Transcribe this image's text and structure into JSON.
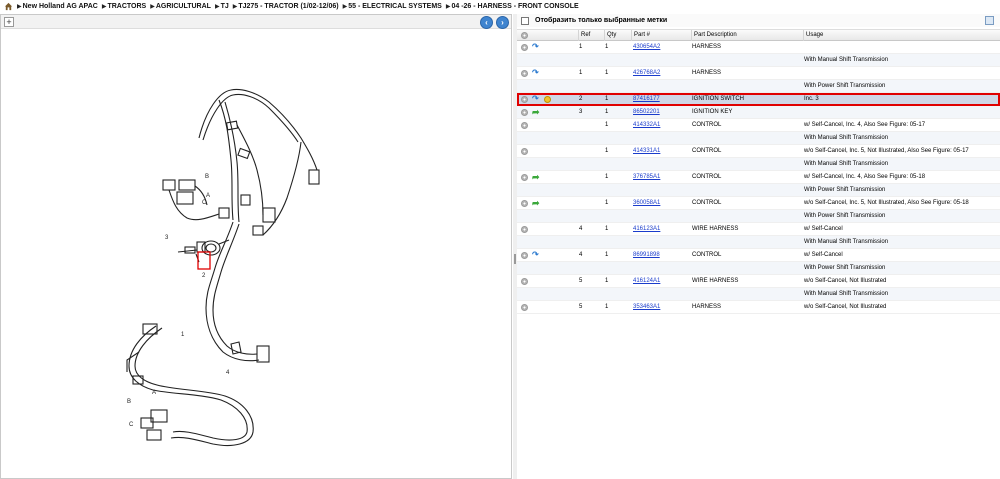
{
  "breadcrumb": {
    "items": [
      "New Holland AG APAC",
      "TRACTORS",
      "AGRICULTURAL",
      "TJ",
      "TJ275 - TRACTOR (1/02-12/06)",
      "55 - ELECTRICAL SYSTEMS",
      "04 -26 - HARNESS - FRONT CONSOLE"
    ]
  },
  "diagram": {
    "callouts": [
      "1",
      "2",
      "3",
      "4",
      "A",
      "B",
      "C",
      "A",
      "B",
      "C"
    ]
  },
  "filter": {
    "label": "Отобразить только выбранные метки",
    "checked": false
  },
  "table": {
    "headers": [
      "Ref",
      "Qty",
      "Part #",
      "Part Description",
      "Usage"
    ],
    "rows": [
      {
        "icons": "blue",
        "ref": "1",
        "qty": "1",
        "part": "430654A2",
        "desc": "HARNESS",
        "usage": ""
      },
      {
        "icons": "",
        "ref": "",
        "qty": "",
        "part": "",
        "desc": "",
        "usage": "With Manual Shift Transmission"
      },
      {
        "icons": "blue",
        "ref": "1",
        "qty": "1",
        "part": "426768A2",
        "desc": "HARNESS",
        "usage": ""
      },
      {
        "icons": "",
        "ref": "",
        "qty": "",
        "part": "",
        "desc": "",
        "usage": "With Power Shift Transmission"
      },
      {
        "icons": "blue-yellow",
        "ref": "2",
        "qty": "1",
        "part": "87416177",
        "desc": "IGNITION SWITCH",
        "usage": "Inc. 3",
        "selected": true
      },
      {
        "icons": "green",
        "ref": "3",
        "qty": "1",
        "part": "86502201",
        "desc": "IGNITION KEY",
        "usage": ""
      },
      {
        "icons": "",
        "ref": "",
        "qty": "1",
        "part": "414332A1",
        "desc": "CONTROL",
        "usage": "w/ Self-Cancel, Inc. 4, Also See Figure: 05-17"
      },
      {
        "icons": "",
        "ref": "",
        "qty": "",
        "part": "",
        "desc": "",
        "usage": "With Manual Shift Transmission"
      },
      {
        "icons": "",
        "ref": "",
        "qty": "1",
        "part": "414331A1",
        "desc": "CONTROL",
        "usage": "w/o Self-Cancel, Inc. 5, Not Illustrated, Also See Figure: 05-17"
      },
      {
        "icons": "",
        "ref": "",
        "qty": "",
        "part": "",
        "desc": "",
        "usage": "With Manual Shift Transmission"
      },
      {
        "icons": "green",
        "ref": "",
        "qty": "1",
        "part": "376785A1",
        "desc": "CONTROL",
        "usage": "w/ Self-Cancel, Inc. 4, Also See Figure: 05-18"
      },
      {
        "icons": "",
        "ref": "",
        "qty": "",
        "part": "",
        "desc": "",
        "usage": "With Power Shift Transmission"
      },
      {
        "icons": "green",
        "ref": "",
        "qty": "1",
        "part": "360058A1",
        "desc": "CONTROL",
        "usage": "w/o Self-Cancel, Inc. 5, Not Illustrated, Also See Figure: 05-18"
      },
      {
        "icons": "",
        "ref": "",
        "qty": "",
        "part": "",
        "desc": "",
        "usage": "With Power Shift Transmission"
      },
      {
        "icons": "",
        "ref": "4",
        "qty": "1",
        "part": "416123A1",
        "desc": "WIRE HARNESS",
        "usage": "w/ Self-Cancel"
      },
      {
        "icons": "",
        "ref": "",
        "qty": "",
        "part": "",
        "desc": "",
        "usage": "With Manual Shift Transmission"
      },
      {
        "icons": "blue",
        "ref": "4",
        "qty": "1",
        "part": "86991898",
        "desc": "CONTROL",
        "usage": "w/ Self-Cancel"
      },
      {
        "icons": "",
        "ref": "",
        "qty": "",
        "part": "",
        "desc": "",
        "usage": "With Power Shift Transmission"
      },
      {
        "icons": "",
        "ref": "5",
        "qty": "1",
        "part": "416124A1",
        "desc": "WIRE HARNESS",
        "usage": "w/o Self-Cancel, Not Illustrated"
      },
      {
        "icons": "",
        "ref": "",
        "qty": "",
        "part": "",
        "desc": "",
        "usage": "With Manual Shift Transmission"
      },
      {
        "icons": "",
        "ref": "5",
        "qty": "1",
        "part": "353463A1",
        "desc": "HARNESS",
        "usage": "w/o Self-Cancel, Not Illustrated"
      }
    ]
  },
  "colors": {
    "highlight": "#e00000",
    "link": "#1a3ccc",
    "nav_blue": "#3f84cf"
  }
}
